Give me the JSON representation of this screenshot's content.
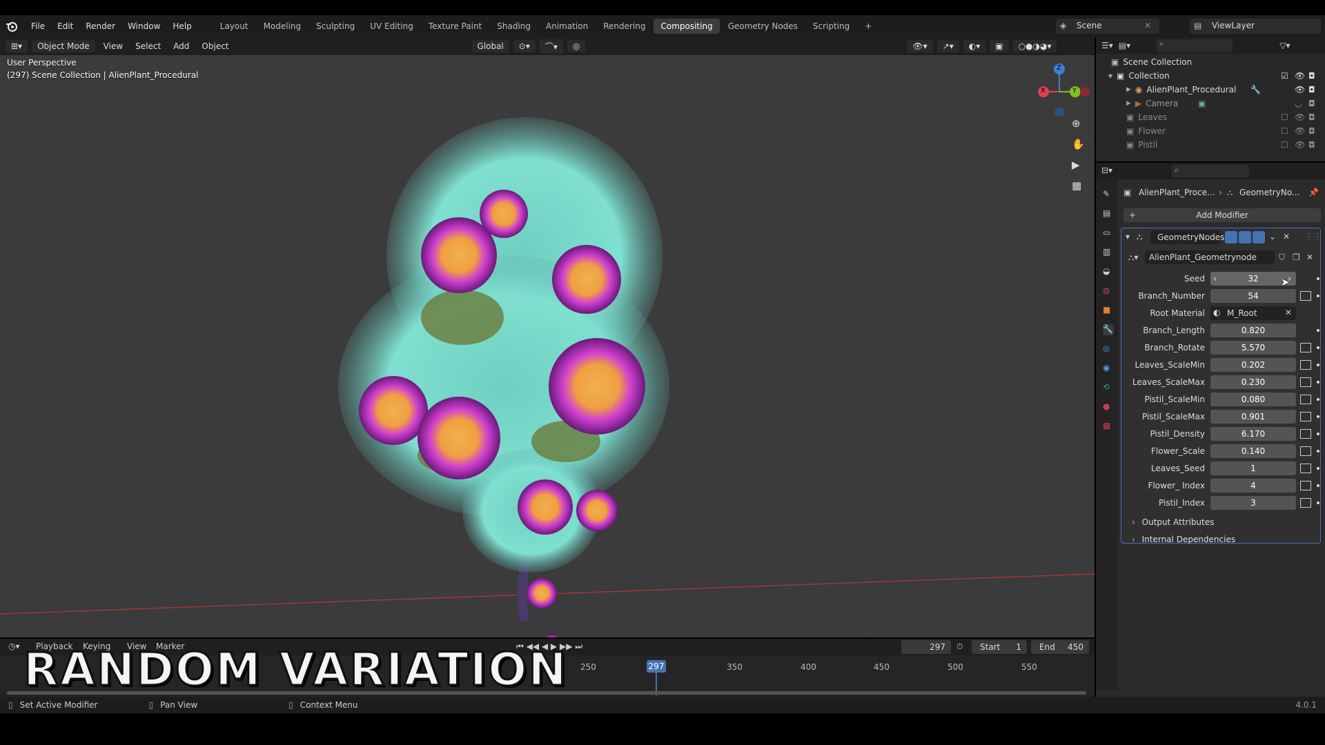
{
  "menu": [
    "File",
    "Edit",
    "Render",
    "Window",
    "Help"
  ],
  "workspaces": [
    "Layout",
    "Modeling",
    "Sculpting",
    "UV Editing",
    "Texture Paint",
    "Shading",
    "Animation",
    "Rendering",
    "Compositing",
    "Geometry Nodes",
    "Scripting"
  ],
  "active_workspace_index": 8,
  "scene": {
    "name": "Scene",
    "view_layer": "ViewLayer"
  },
  "viewport_header": {
    "mode": "Object Mode",
    "view": "View",
    "select": "Select",
    "add": "Add",
    "object": "Object",
    "orientation": "Global"
  },
  "viewport": {
    "line1": "User Perspective",
    "line2": "(297) Scene Collection | AlienPlant_Procedural",
    "gizmo": {
      "z": "Z",
      "y": "Y",
      "x": "X"
    }
  },
  "outliner": {
    "root": "Scene Collection",
    "collection": "Collection",
    "items": [
      "AlienPlant_Procedural",
      "Camera"
    ],
    "extra": [
      "Leaves",
      "Flower",
      "Pistil"
    ]
  },
  "properties": {
    "breadcrumb_object": "AlienPlant_Proce...",
    "breadcrumb_modifier": "GeometryNo...",
    "add_modifier": "Add Modifier",
    "modifier_name": "GeometryNodes",
    "node_group": "AlienPlant_Geometrynode",
    "inputs": [
      {
        "label": "Seed",
        "value": "32"
      },
      {
        "label": "Branch_Number",
        "value": "54"
      },
      {
        "label": "Root Material",
        "value": "M_Root"
      },
      {
        "label": "Branch_Length",
        "value": "0.820"
      },
      {
        "label": "Branch_Rotate",
        "value": "5.570"
      },
      {
        "label": "Leaves_ScaleMin",
        "value": "0.202"
      },
      {
        "label": "Leaves_ScaleMax",
        "value": "0.230"
      },
      {
        "label": "Pistil_ScaleMin",
        "value": "0.080"
      },
      {
        "label": "Pistil_ScaleMax",
        "value": "0.901"
      },
      {
        "label": "Pistil_Density",
        "value": "6.170"
      },
      {
        "label": "Flower_Scale",
        "value": "0.140"
      },
      {
        "label": "Leaves_Seed",
        "value": "1"
      },
      {
        "label": "Flower_ Index",
        "value": "4"
      },
      {
        "label": "Pistil_Index",
        "value": "3"
      }
    ],
    "panels": [
      "Output Attributes",
      "Internal Dependencies"
    ]
  },
  "timeline": {
    "current_frame": "297",
    "start_label": "Start",
    "start": "1",
    "end_label": "End",
    "end": "450",
    "ticks": [
      "250",
      "297",
      "350",
      "400",
      "450",
      "500",
      "550"
    ],
    "menus": [
      "Playback",
      "Keying",
      "View",
      "Marker"
    ]
  },
  "overlay_title": "RANDOM VARIATION",
  "statusbar": {
    "left": "Set Active Modifier",
    "mid": "Pan View",
    "right": "Context Menu",
    "version": "4.0.1"
  },
  "colors": {
    "accent": "#4772b3",
    "x_axis": "#e0404f",
    "y_axis": "#80c020",
    "z_axis": "#3d7fd6",
    "flower_cyan": "#7fe0d0",
    "flower_magenta": "#c040c0"
  }
}
